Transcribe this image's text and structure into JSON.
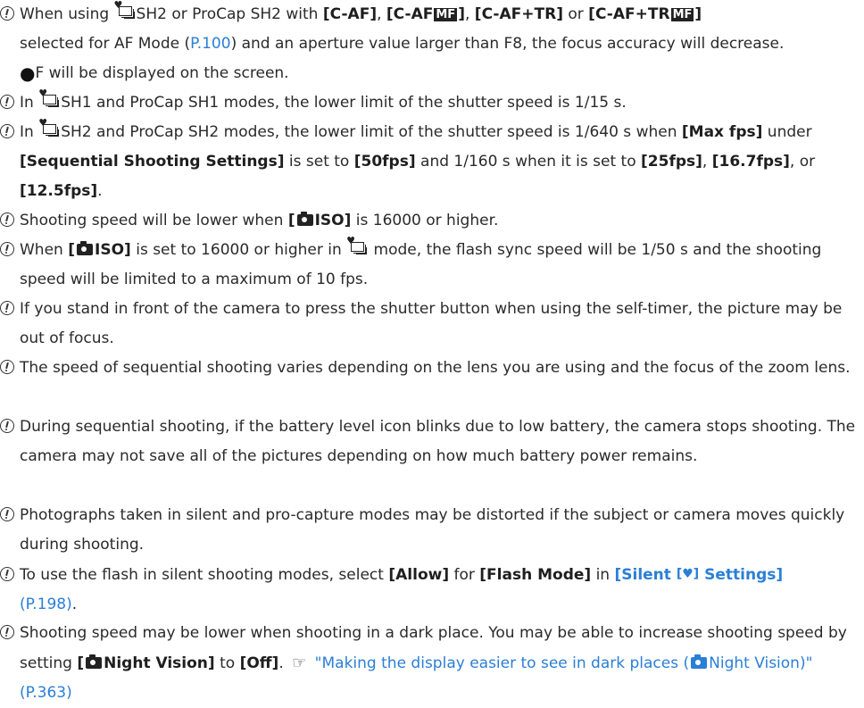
{
  "notes": [
    {
      "p1": "When using ",
      "p2": "SH2 or ProCap SH2 with ",
      "b1": "[C-AF]",
      "p3": ", ",
      "b2a": "[C-AF",
      "mf1": "MF",
      "b2b": "]",
      "p4": ", ",
      "b3": "[C-AF+TR]",
      "p5": " or ",
      "b4a": "[C-AF+TR",
      "mf2": "MF",
      "b4b": "]",
      "p6": "selected for AF Mode (",
      "link": "P.100",
      "p7": ") and an aperture value larger than F8, the focus accuracy will decrease.",
      "dot": "●",
      "p8": "F will be displayed on the screen."
    },
    {
      "p1": "In ",
      "p2": "SH1 and ProCap SH1 modes, the lower limit of the shutter speed is 1/15 s."
    },
    {
      "p1": "In ",
      "p2": "SH2 and ProCap SH2 modes, the lower limit of the shutter speed is 1/640 s when ",
      "b1": "[Max fps]",
      "p3": " under ",
      "b2": "[Sequential Shooting Settings]",
      "p4": " is set to ",
      "b3": "[50fps]",
      "p5": " and 1/160 s when it is set to ",
      "b4": "[25fps]",
      "p6": ", ",
      "b5": "[16.7fps]",
      "p7": ", or ",
      "b6": "[12.5fps]",
      "p8": "."
    },
    {
      "p1": "Shooting speed will be lower when ",
      "b1a": "[",
      "b1b": "ISO]",
      "p2": " is 16000 or higher."
    },
    {
      "p1": "When ",
      "b1a": "[",
      "b1b": "ISO]",
      "p2": " is set to 16000 or higher in ",
      "p3": " mode, the flash sync speed will be 1/50 s and the shooting speed will be limited to a maximum of 10 fps."
    },
    {
      "text": "If you stand in front of the camera to press the shutter button when using the self-timer, the picture may be out of focus."
    },
    {
      "text": "The speed of sequential shooting varies depending on the lens you are using and the focus of the zoom lens."
    },
    {
      "text": "During sequential shooting, if the battery level icon blinks due to low battery, the camera stops shooting. The camera may not save all of the pictures depending on how much battery power remains."
    },
    {
      "text": "Photographs taken in silent and pro-capture modes may be distorted if the subject or camera moves quickly during shooting."
    },
    {
      "p1": "To use the flash in silent shooting modes, select ",
      "b1": "[Allow]",
      "p2": " for ",
      "b2": "[Flash Mode]",
      "p3": " in ",
      "l1a": "[Silent ",
      "l1heart": "[♥]",
      "l1b": " Settings]",
      "l2": "(P.198)",
      "p4": "."
    },
    {
      "p1": "Shooting speed may be lower when shooting in a dark place. You may be able to increase shooting speed by setting ",
      "b1a": "[",
      "b1b": "Night Vision]",
      "p2": " to ",
      "b2": "[Off]",
      "p3": ". ",
      "ref": "☞",
      "l1": " \"Making the display easier to see in dark places (",
      "l2": "Night Vision)\" (P.363)"
    }
  ]
}
